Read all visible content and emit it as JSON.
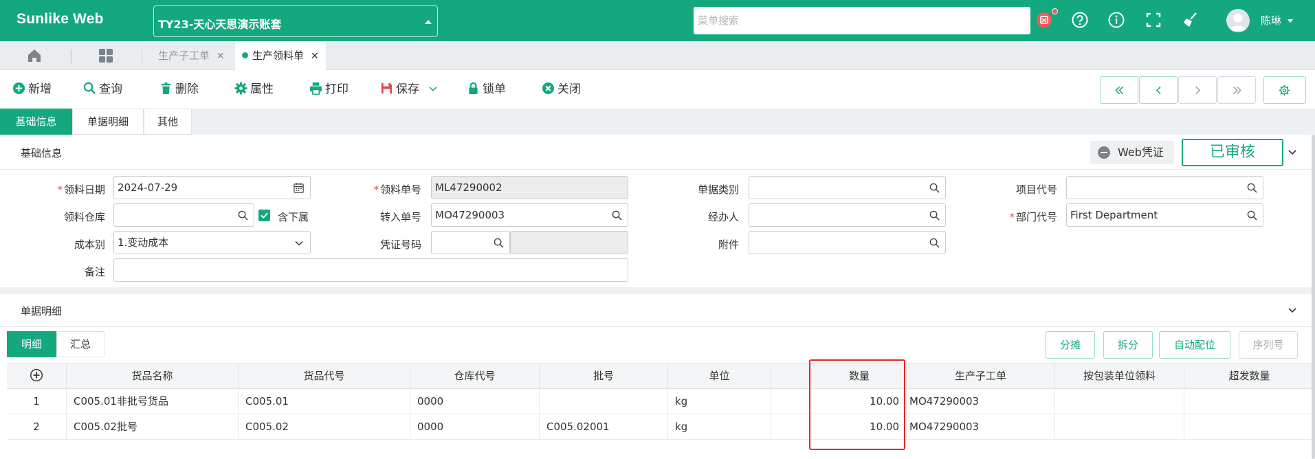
{
  "header": {
    "logo": "Sunlike Web",
    "account": "TY23-天心天思演示账套",
    "search_placeholder": "菜单搜索",
    "user_name": "陈琳"
  },
  "page_tabs": [
    {
      "label": "生产子工单"
    },
    {
      "label": "生产领料单"
    }
  ],
  "toolbar": {
    "add": "新增",
    "query": "查询",
    "delete": "删除",
    "props": "属性",
    "print": "打印",
    "save": "保存",
    "lock": "锁单",
    "close": "关闭"
  },
  "section_tabs": [
    "基础信息",
    "单据明细",
    "其他"
  ],
  "basic": {
    "title": "基础信息",
    "web_voucher": "Web凭证",
    "status": "已审核",
    "fields": {
      "pick_date_label": "领料日期",
      "pick_date": "2024-07-29",
      "pick_no_label": "领料单号",
      "pick_no": "ML47290002",
      "doc_type_label": "单据类别",
      "doc_type": "",
      "project_label": "项目代号",
      "project": "",
      "warehouse_label": "领料仓库",
      "warehouse": "",
      "include_sub_label": "含下属",
      "transfer_label": "转入单号",
      "transfer_no": "MO47290003",
      "handler_label": "经办人",
      "handler": "",
      "dept_label": "部门代号",
      "dept": "First Department",
      "cost_type_label": "成本别",
      "cost_type": "1.变动成本",
      "voucher_label": "凭证号码",
      "voucher": "",
      "attach_label": "附件",
      "attach": "",
      "remark_label": "备注",
      "remark": ""
    }
  },
  "detail": {
    "title": "单据明细",
    "tabs": [
      "明细",
      "汇总"
    ],
    "actions": [
      "分摊",
      "拆分",
      "自动配位",
      "序列号"
    ],
    "columns": [
      "货品名称",
      "货品代号",
      "仓库代号",
      "批号",
      "单位",
      "数量",
      "生产子工单",
      "按包装单位领料",
      "超发数量"
    ],
    "rows": [
      {
        "idx": "1",
        "name": "C005.01非批号货品",
        "code": "C005.01",
        "wh": "0000",
        "batch": "",
        "unit": "kg",
        "qty": "10.00",
        "sub_order": "MO47290003",
        "pkg": "",
        "over": ""
      },
      {
        "idx": "2",
        "name": "C005.02批号",
        "code": "C005.02",
        "wh": "0000",
        "batch": "C005.02001",
        "unit": "kg",
        "qty": "10.00",
        "sub_order": "MO47290003",
        "pkg": "",
        "over": ""
      }
    ]
  }
}
